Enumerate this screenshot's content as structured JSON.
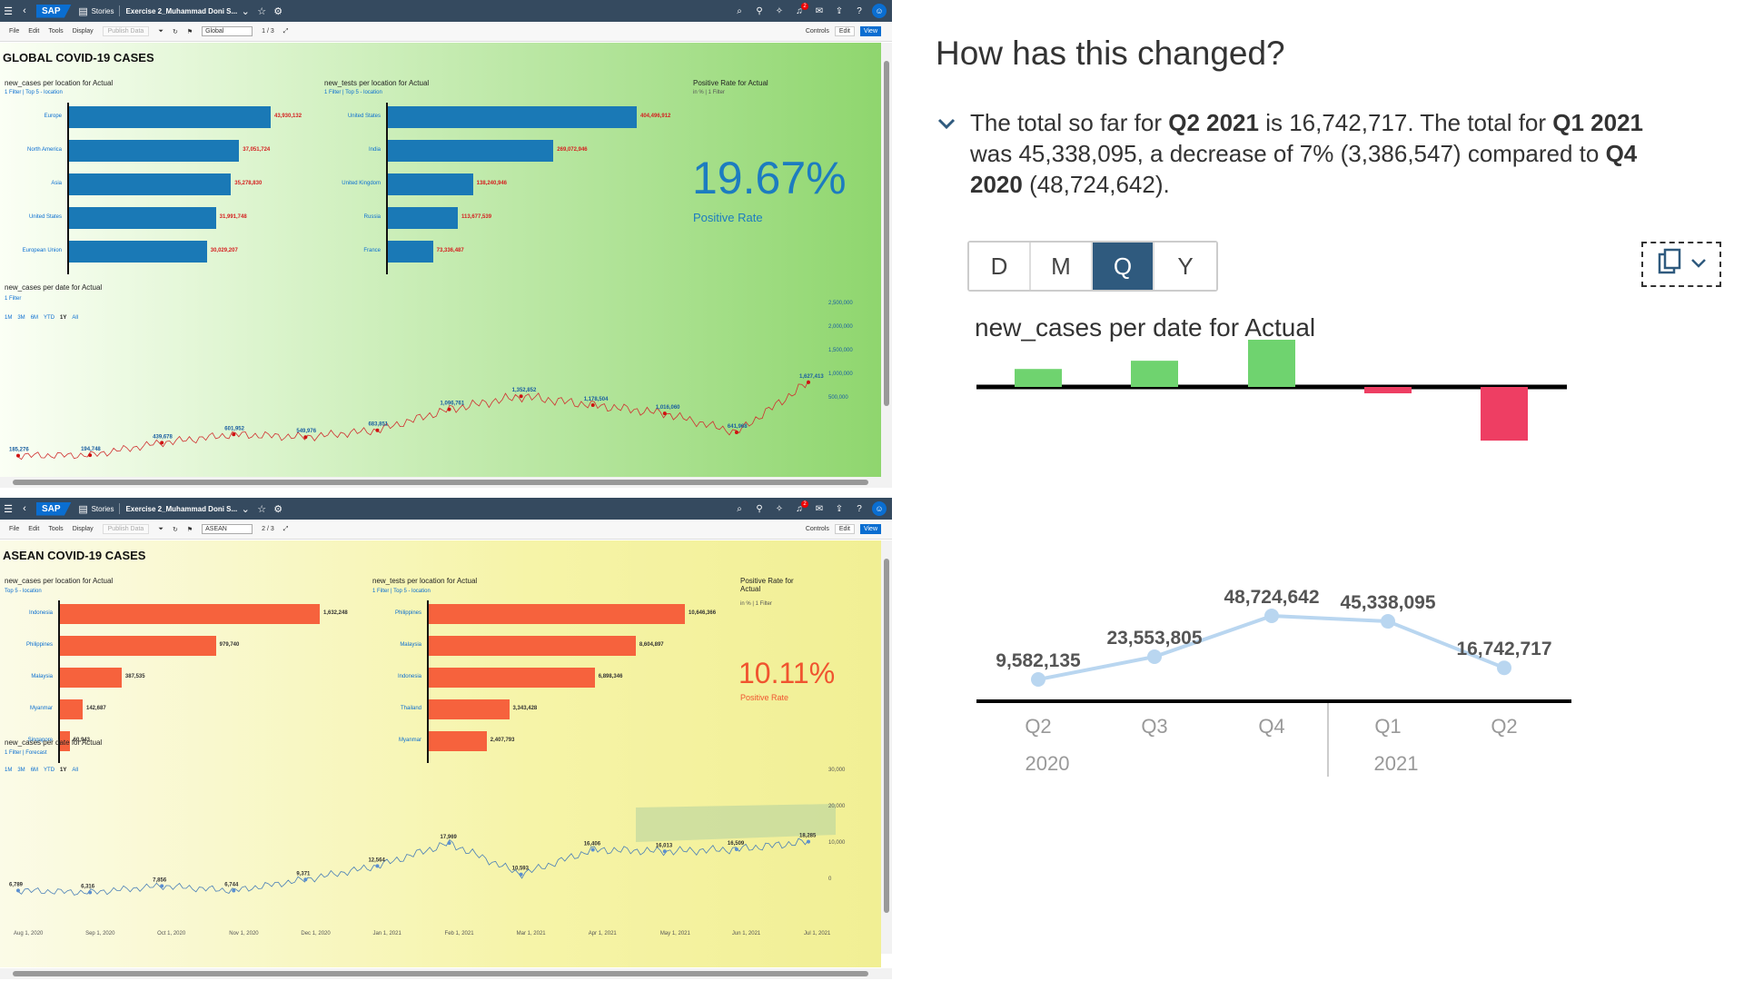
{
  "shell": {
    "stories_label": "Stories",
    "story_name": "Exercise 2_Muhammad Doni S...",
    "notification_count": "2",
    "logo": "SAP"
  },
  "toolbar": {
    "file": "File",
    "edit_menu": "Edit",
    "tools": "Tools",
    "display": "Display",
    "publish": "Publish Data",
    "controls": "Controls",
    "edit_btn": "Edit",
    "view_btn": "View"
  },
  "global": {
    "title": "GLOBAL COVID-19 CASES",
    "page_select": "Global",
    "page_indicator": "1 / 3",
    "cases_title": "new_cases per location for Actual",
    "cases_filters": "1 Filter  |  Top 5 - location",
    "cases_locations": [
      "Europe",
      "North America",
      "Asia",
      "United States",
      "European Union"
    ],
    "cases_values": [
      43930132,
      37051724,
      35278830,
      31991748,
      30029207
    ],
    "cases_labels": [
      "43,930,132",
      "37,051,724",
      "35,278,830",
      "31,991,748",
      "30,029,207"
    ],
    "tests_title": "new_tests per location for Actual",
    "tests_filters": "1 Filter  |  Top 5 - location",
    "tests_locations": [
      "United States",
      "India",
      "United Kingdom",
      "Russia",
      "France"
    ],
    "tests_values": [
      404496912,
      269072946,
      138240946,
      113677539,
      73336487
    ],
    "tests_labels": [
      "404,496,912",
      "269,072,946",
      "138,240,946",
      "113,677,539",
      "73,336,487"
    ],
    "rate_title": "Positive Rate for Actual",
    "rate_meta": "in %  |  1 Filter",
    "rate_value": "19.67%",
    "rate_label": "Positive Rate",
    "ts_title": "new_cases per date for Actual",
    "ts_filters": "1 Filter",
    "ranges": [
      "1M",
      "3M",
      "6M",
      "YTD",
      "1Y",
      "All"
    ],
    "ts_yticks": [
      "2,500,000",
      "2,000,000",
      "1,500,000",
      "1,000,000",
      "500,000"
    ],
    "ts_points": [
      {
        "label": "185,276",
        "v": 185276
      },
      {
        "label": "194,748",
        "v": 194748
      },
      {
        "label": "439,678",
        "v": 439678
      },
      {
        "label": "601,952",
        "v": 601952
      },
      {
        "label": "549,976",
        "v": 549976
      },
      {
        "label": "683,851",
        "v": 683851
      },
      {
        "label": "1,096,761",
        "v": 1096761
      },
      {
        "label": "1,352,852",
        "v": 1352852
      },
      {
        "label": "1,178,504",
        "v": 1178504
      },
      {
        "label": "1,016,060",
        "v": 1016060
      },
      {
        "label": "641,968",
        "v": 641968
      },
      {
        "label": "1,627,413",
        "v": 1627413
      }
    ]
  },
  "asean": {
    "title": "ASEAN COVID-19 CASES",
    "page_select": "ASEAN",
    "page_indicator": "2 / 3",
    "cases_title": "new_cases per location for Actual",
    "cases_filters": "Top 5 - location",
    "cases_locations": [
      "Indonesia",
      "Philippines",
      "Malaysia",
      "Myanmar",
      "Singapore"
    ],
    "cases_values": [
      1632248,
      979740,
      387535,
      142687,
      60943
    ],
    "cases_labels": [
      "1,632,248",
      "979,740",
      "387,535",
      "142,687",
      "60,943"
    ],
    "tests_title": "new_tests per location for Actual",
    "tests_filters": "1 Filter  |  Top 5 - location",
    "tests_locations": [
      "Philippines",
      "Malaysia",
      "Indonesia",
      "Thailand",
      "Myanmar"
    ],
    "tests_values": [
      10646366,
      8604897,
      6898346,
      3343428,
      2407793
    ],
    "tests_labels": [
      "10,646,366",
      "8,604,897",
      "6,898,346",
      "3,343,428",
      "2,407,793"
    ],
    "rate_title": "Positive Rate for Actual",
    "rate_meta": "in %  |  1 Filter",
    "rate_value": "10.11%",
    "rate_label": "Positive Rate",
    "ts_title": "new_cases per date for Actual",
    "ts_filters": "1 Filter  |  Forecast",
    "ranges": [
      "1M",
      "3M",
      "6M",
      "YTD",
      "1Y",
      "All"
    ],
    "ts_yticks": [
      "30,000",
      "20,000",
      "10,000",
      "0"
    ],
    "ts_xticks": [
      "Aug 1, 2020",
      "Sep 1, 2020",
      "Oct 1, 2020",
      "Nov 1, 2020",
      "Dec 1, 2020",
      "Jan 1, 2021",
      "Feb 1, 2021",
      "Mar 1, 2021",
      "Apr 1, 2021",
      "May 1, 2021",
      "Jun 1, 2021",
      "Jul 1, 2021"
    ],
    "ts_points": [
      {
        "label": "6,789",
        "v": 6789
      },
      {
        "label": "6,316",
        "v": 6316
      },
      {
        "label": "7,856",
        "v": 7856
      },
      {
        "label": "6,744",
        "v": 6744
      },
      {
        "label": "9,371",
        "v": 9371
      },
      {
        "label": "12,564",
        "v": 12564
      },
      {
        "label": "17,969",
        "v": 17969
      },
      {
        "label": "10,593",
        "v": 10593
      },
      {
        "label": "16,406",
        "v": 16406
      },
      {
        "label": "16,013",
        "v": 16013
      },
      {
        "label": "16,509",
        "v": 16509
      },
      {
        "label": "18,285",
        "v": 18285
      }
    ]
  },
  "panel": {
    "heading": "How has this changed?",
    "summary": {
      "p1": "The total so far for ",
      "b1": "Q2 2021",
      "p2": " is 16,742,717. The total for ",
      "b2": "Q1 2021",
      "p3": " was 45,338,095, a decrease of 7% (3,386,547) compared to ",
      "b3": "Q4 2020",
      "p4": " (48,724,642)."
    },
    "granularity": [
      "D",
      "M",
      "Q",
      "Y"
    ],
    "granularity_selected": "Q",
    "chart_title": "new_cases per date for Actual",
    "colors": {
      "increase": "#6fd36f",
      "decrease": "#ee3e63",
      "line": "#b9d6f0",
      "selected": "#2f5a7e"
    }
  },
  "chart_data": [
    {
      "type": "bar",
      "title": "new_cases per location for Actual",
      "categories": [
        "Europe",
        "North America",
        "Asia",
        "United States",
        "European Union"
      ],
      "values": [
        43930132,
        37051724,
        35278830,
        31991748,
        30029207
      ]
    },
    {
      "type": "bar",
      "title": "new_tests per location for Actual",
      "categories": [
        "United States",
        "India",
        "United Kingdom",
        "Russia",
        "France"
      ],
      "values": [
        404496912,
        269072946,
        138240946,
        113677539,
        73336487
      ]
    },
    {
      "type": "bar",
      "title": "new_cases per location for Actual",
      "categories": [
        "Indonesia",
        "Philippines",
        "Malaysia",
        "Myanmar",
        "Singapore"
      ],
      "values": [
        1632248,
        979740,
        387535,
        142687,
        60943
      ]
    },
    {
      "type": "bar",
      "title": "new_tests per location for Actual",
      "categories": [
        "Philippines",
        "Malaysia",
        "Indonesia",
        "Thailand",
        "Myanmar"
      ],
      "values": [
        10646366,
        8604897,
        6898346,
        3343428,
        2407793
      ]
    },
    {
      "type": "bar",
      "title": "new_cases per date for Actual",
      "categories": [
        "Q2 2020",
        "Q3 2020",
        "Q4 2020",
        "Q1 2021",
        "Q2 2021"
      ],
      "values": [
        9582135,
        23553805,
        48724642,
        45338095,
        16742717
      ],
      "changes": [
        9582135,
        13971670,
        25170837,
        -3386547,
        -28595378
      ],
      "value_labels": [
        "9,582,135",
        "23,553,805",
        "48,724,642",
        "45,338,095",
        "16,742,717"
      ],
      "x_quarters": [
        "Q2",
        "Q3",
        "Q4",
        "Q1",
        "Q2"
      ],
      "x_years": [
        "2020",
        "2021"
      ]
    }
  ]
}
